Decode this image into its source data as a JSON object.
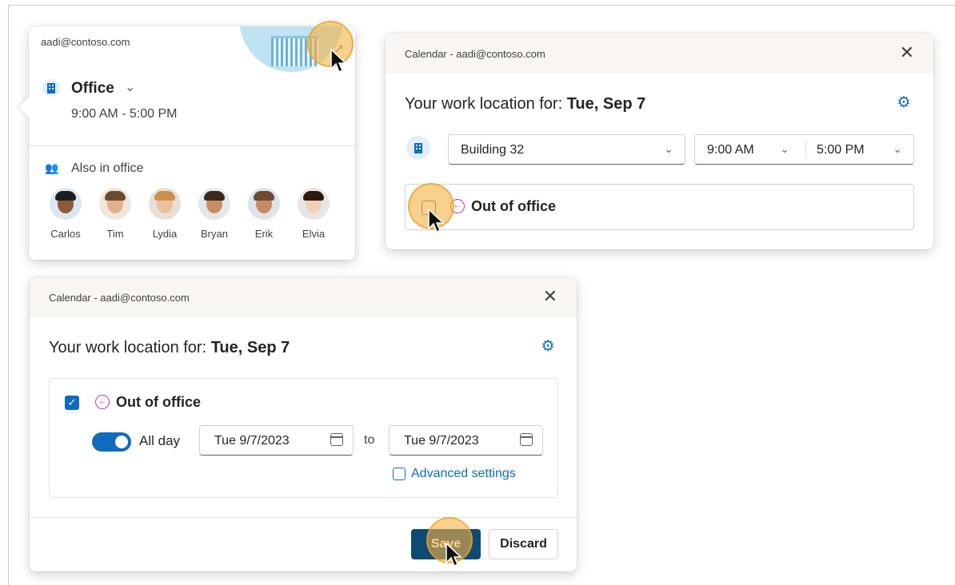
{
  "peek": {
    "email": "aadi@contoso.com",
    "location": "Office",
    "time": "9:00 AM - 5:00 PM",
    "also_label": "Also in office",
    "people": [
      {
        "name": "Carlos",
        "skin": "#8d5a3b",
        "hair": "#1e1e1e",
        "bg": "#dce6ef"
      },
      {
        "name": "Tim",
        "skin": "#e2b08f",
        "hair": "#6b4a2f",
        "bg": "#efe6dc"
      },
      {
        "name": "Lydia",
        "skin": "#eac0a0",
        "hair": "#c9924a",
        "bg": "#e8dfd6"
      },
      {
        "name": "Bryan",
        "skin": "#c98d66",
        "hair": "#3a2a1e",
        "bg": "#e2e7ea"
      },
      {
        "name": "Erik",
        "skin": "#c58b68",
        "hair": "#6e4a33",
        "bg": "#dde3e8"
      },
      {
        "name": "Elvia",
        "skin": "#f0d0b8",
        "hair": "#2a1a12",
        "bg": "#e9e5e2"
      }
    ]
  },
  "dialog2": {
    "title": "Calendar - aadi@contoso.com",
    "heading_prefix": "Your work location for:",
    "heading_date": "Tue, Sep 7",
    "building": "Building 32",
    "start_time": "9:00 AM",
    "end_time": "5:00 PM",
    "ooo_label": "Out of office"
  },
  "dialog3": {
    "title": "Calendar - aadi@contoso.com",
    "heading_prefix": "Your work location for:",
    "heading_date": "Tue, Sep 7",
    "ooo_label": "Out of office",
    "all_day_label": "All day",
    "start_date": "Tue 9/7/2023",
    "to_label": "to",
    "end_date": "Tue 9/7/2023",
    "advanced_label": "Advanced settings",
    "save_label": "Save",
    "discard_label": "Discard"
  },
  "colors": {
    "accent": "#0f6cbd",
    "save_button": "#0f4a73",
    "out_of_office": "#c239b3",
    "click_highlight": "#f5b041"
  }
}
